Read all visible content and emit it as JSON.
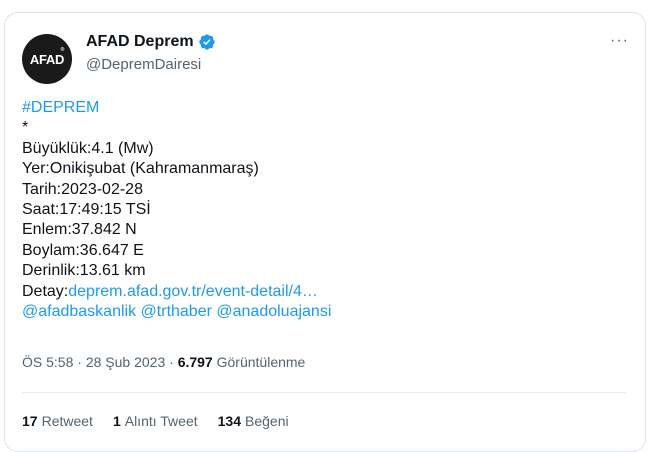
{
  "author": {
    "avatar_text": "AFAD",
    "avatar_mark": "®",
    "display_name": "AFAD Deprem",
    "handle": "@DepremDairesi",
    "verified_color": "#1d9bf0"
  },
  "more_menu": "···",
  "tweet": {
    "hashtag": "#DEPREM",
    "bullet": "*",
    "lines": [
      "Büyüklük:4.1 (Mw)",
      "Yer:Onikişubat (Kahramanmaraş)",
      "Tarih:2023-02-28",
      "Saat:17:49:15 TSİ",
      "Enlem:37.842 N",
      "Boylam:36.647 E",
      "Derinlik:13.61 km"
    ],
    "detail_label": "Detay:",
    "detail_link": "deprem.afad.gov.tr/event-detail/4…",
    "mentions": [
      "@afadbaskanlik",
      "@trthaber",
      "@anadoluajansi"
    ]
  },
  "meta": {
    "time": "ÖS 5:58",
    "separator": "·",
    "date": "28 Şub 2023",
    "views_count": "6.797",
    "views_label": "Görüntülenme"
  },
  "stats": {
    "retweets_count": "17",
    "retweets_label": "Retweet",
    "quotes_count": "1",
    "quotes_label": "Alıntı Tweet",
    "likes_count": "134",
    "likes_label": "Beğeni"
  },
  "colors": {
    "link": "#1d9bf0",
    "text": "#0f1419",
    "muted": "#536471"
  }
}
